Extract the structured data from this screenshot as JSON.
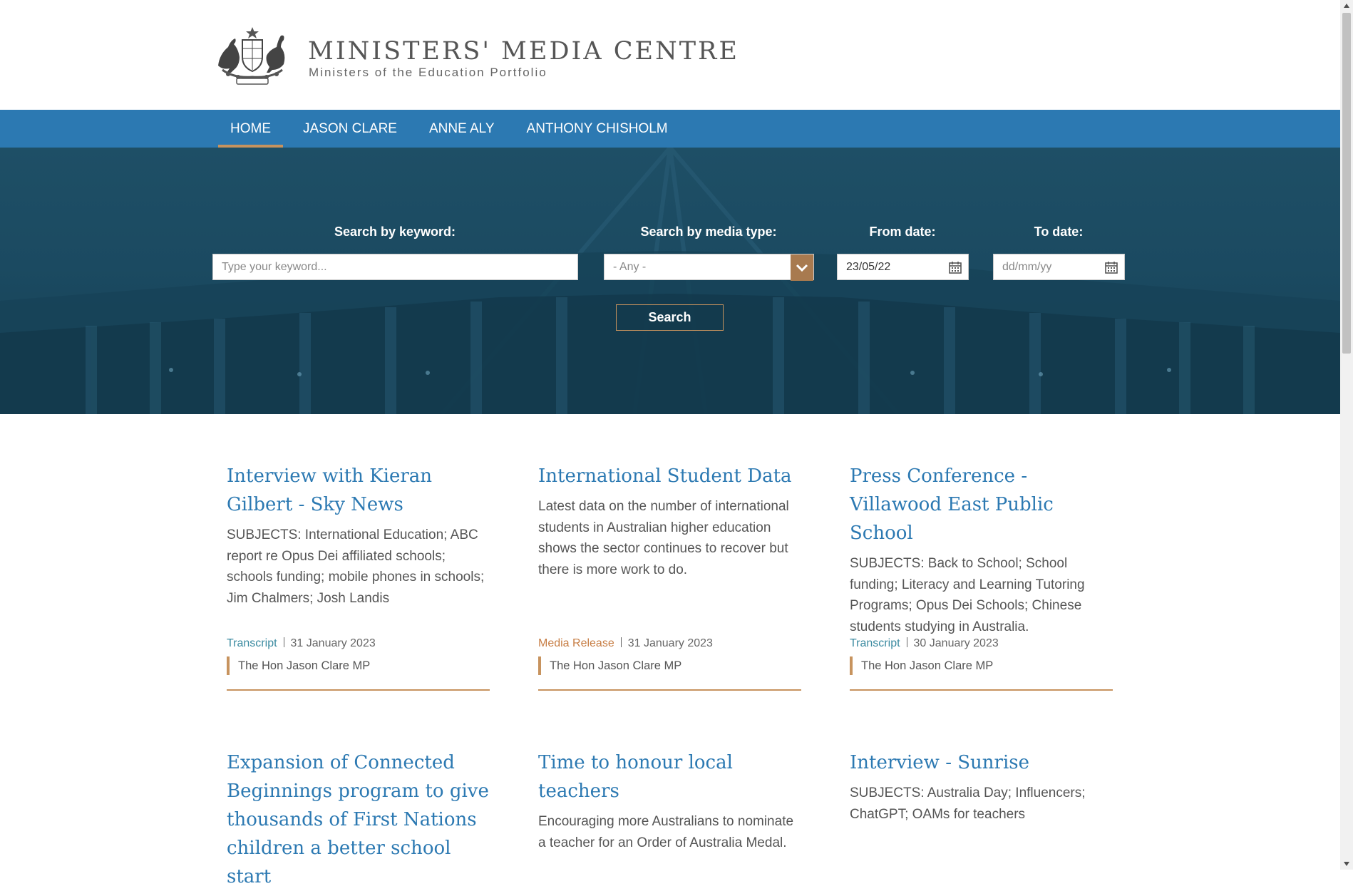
{
  "site": {
    "title": "MINISTERS' MEDIA CENTRE",
    "subtitle": "Ministers of the Education Portfolio",
    "logo_icon": "coat-of-arms-crest-icon"
  },
  "nav": {
    "items": [
      {
        "label": "HOME",
        "active": true
      },
      {
        "label": "JASON CLARE",
        "active": false
      },
      {
        "label": "ANNE ALY",
        "active": false
      },
      {
        "label": "ANTHONY CHISHOLM",
        "active": false
      }
    ]
  },
  "search": {
    "keyword_label": "Search by keyword:",
    "keyword_placeholder": "Type your keyword...",
    "media_type_label": "Search by media type:",
    "media_type_value": "- Any -",
    "from_date_label": "From date:",
    "from_date_value": "23/05/22",
    "to_date_label": "To date:",
    "to_date_placeholder": "dd/mm/yy",
    "button_label": "Search"
  },
  "articles": [
    {
      "title": "Interview with Kieran Gilbert - Sky News",
      "summary": "SUBJECTS: International Education; ABC report re Opus Dei affiliated schools; schools funding; mobile phones in schools; Jim Chalmers; Josh Landis",
      "type": "Transcript",
      "date": "31 January 2023",
      "minister": "The Hon Jason Clare MP"
    },
    {
      "title": "International Student Data",
      "summary": "Latest data on the number of international students in Australian higher education shows the sector continues to recover but there is more work to do.",
      "type": "Media Release",
      "date": "31 January 2023",
      "minister": "The Hon Jason Clare MP"
    },
    {
      "title": "Press Conference - Villawood East Public School",
      "summary": "SUBJECTS: Back to School; School funding; Literacy and Learning Tutoring Programs; Opus Dei Schools; Chinese students studying in Australia.",
      "type": "Transcript",
      "date": "30 January 2023",
      "minister": "The Hon Jason Clare MP"
    },
    {
      "title": "Expansion of Connected Beginnings program to give thousands of First Nations children a better school start",
      "summary": ""
    },
    {
      "title": "Time to honour local teachers",
      "summary": "Encouraging more Australians to nominate a teacher for an Order of Australia Medal."
    },
    {
      "title": "Interview - Sunrise",
      "summary": "SUBJECTS: Australia Day; Influencers; ChatGPT; OAMs for teachers"
    }
  ],
  "colors": {
    "nav_blue": "#2c79b2",
    "accent_bronze": "#c7935e",
    "hero_teal": "#1b4a61",
    "transcript": "#3a8aa0",
    "media_release": "#c77e45"
  }
}
